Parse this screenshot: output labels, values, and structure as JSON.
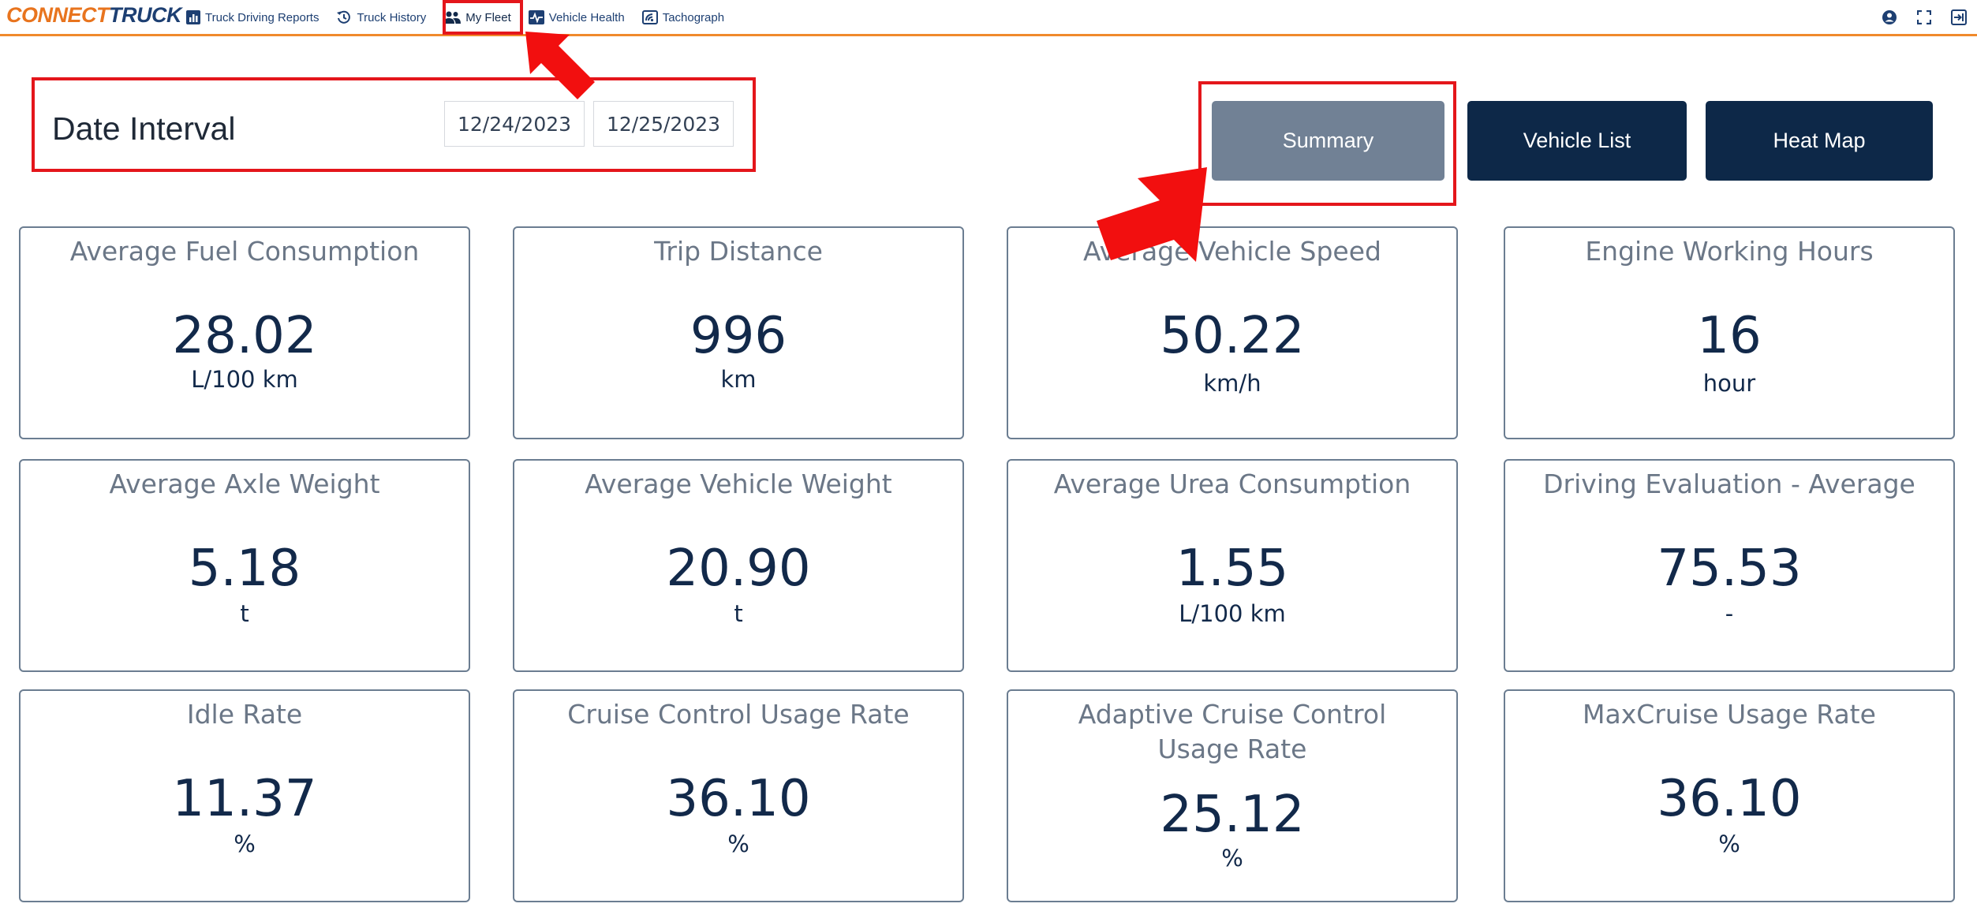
{
  "brand": {
    "part1": "CONNECT",
    "part2": "TRUCK"
  },
  "nav": [
    {
      "label": "Truck Driving Reports",
      "icon": "bar-chart-icon"
    },
    {
      "label": "Truck History",
      "icon": "history-icon"
    },
    {
      "label": "My Fleet",
      "icon": "users-icon"
    },
    {
      "label": "Vehicle Health",
      "icon": "heartbeat-icon"
    },
    {
      "label": "Tachograph",
      "icon": "tachograph-icon"
    }
  ],
  "top_icons": [
    "user-icon",
    "fullscreen-icon",
    "logout-icon"
  ],
  "date_interval": {
    "label": "Date Interval",
    "start": "12/24/2023",
    "end": "12/25/2023"
  },
  "view_buttons": {
    "summary": "Summary",
    "vehicle_list": "Vehicle List",
    "heat_map": "Heat Map"
  },
  "cards": [
    {
      "title": "Average Fuel Consumption",
      "value": "28.02",
      "unit": "L/100 km"
    },
    {
      "title": "Trip Distance",
      "value": "996",
      "unit": "km"
    },
    {
      "title": "Average Vehicle Speed",
      "value": "50.22",
      "unit": "km/h"
    },
    {
      "title": "Engine Working Hours",
      "value": "16",
      "unit": "hour"
    },
    {
      "title": "Average Axle Weight",
      "value": "5.18",
      "unit": "t"
    },
    {
      "title": "Average Vehicle Weight",
      "value": "20.90",
      "unit": "t"
    },
    {
      "title": "Average Urea Consumption",
      "value": "1.55",
      "unit": "L/100 km"
    },
    {
      "title": "Driving Evaluation - Average",
      "value": "75.53",
      "unit": "-"
    },
    {
      "title": "Idle Rate",
      "value": "11.37",
      "unit": "%"
    },
    {
      "title": "Cruise Control Usage Rate",
      "value": "36.10",
      "unit": "%"
    },
    {
      "title": "Adaptive Cruise Control Usage Rate",
      "value": "25.12",
      "unit": "%"
    },
    {
      "title": "MaxCruise Usage Rate",
      "value": "36.10",
      "unit": "%"
    }
  ],
  "colors": {
    "brand_orange": "#e8741e",
    "brand_navy": "#1d3f72",
    "button_navy": "#0d2848",
    "button_active": "#718195",
    "annotation_red": "#e4161b"
  }
}
